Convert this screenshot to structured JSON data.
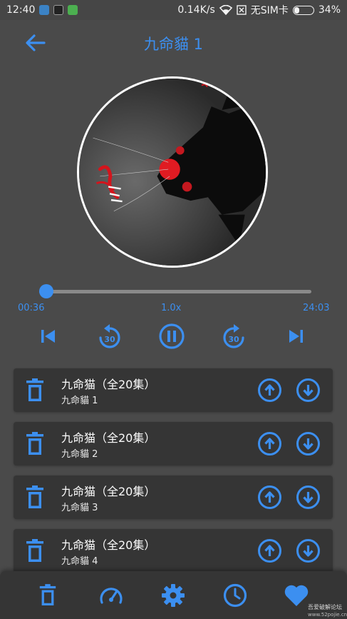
{
  "status_bar": {
    "time": "12:40",
    "network_speed": "0.14K/s",
    "sim": "无SIM卡",
    "battery": "34%",
    "battery_level": 0.34
  },
  "header": {
    "title": "九命貓 1"
  },
  "player": {
    "elapsed": "00:36",
    "speed": "1.0x",
    "duration": "24:03",
    "progress": 0.025,
    "skip_back": "30",
    "skip_forward": "30"
  },
  "playlist": [
    {
      "album": "九命猫（全20集）",
      "episode": "九命貓 1"
    },
    {
      "album": "九命猫（全20集）",
      "episode": "九命貓 2"
    },
    {
      "album": "九命猫（全20集）",
      "episode": "九命貓 3"
    },
    {
      "album": "九命猫（全20集）",
      "episode": "九命貓 4"
    }
  ],
  "watermark": {
    "line1": "吾爱破解论坛",
    "line2": "www.52pojie.cn"
  },
  "colors": {
    "accent": "#3c8ff0",
    "background": "#4a4a4a",
    "card": "#353535"
  }
}
